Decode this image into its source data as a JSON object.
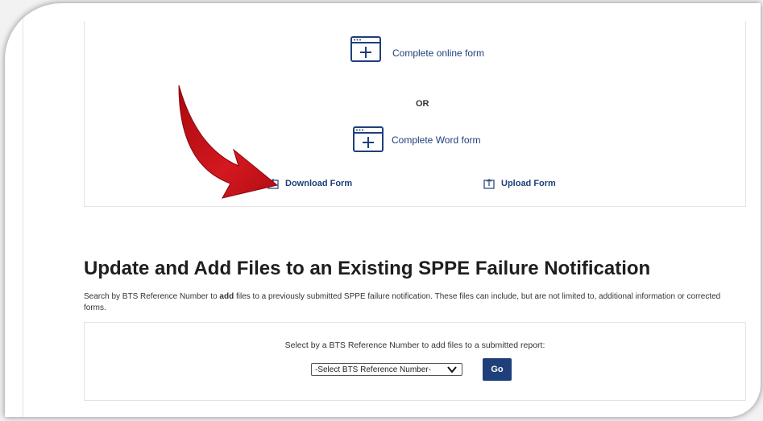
{
  "form_options": {
    "online_label": "Complete online form",
    "or_label": "OR",
    "word_label": "Complete Word form",
    "download_label": "Download Form",
    "upload_label": "Upload Form"
  },
  "update_section": {
    "title_bold": "Update and Add Files",
    "title_rest": " to an Existing SPPE Failure Notification",
    "description_pre": "Search by BTS Reference Number to ",
    "description_bold": "add",
    "description_post": " files to a previously submitted SPPE failure notification. These files can include, but are not limited to, additional information or corrected forms.",
    "select_label": "Select by a BTS Reference Number to add files to a submitted report:",
    "select_value": "-Select BTS Reference Number-",
    "go_label": "Go"
  },
  "colors": {
    "link": "#1f3f7a",
    "arrow": "#c0141a",
    "button_bg": "#1f3f7a"
  },
  "icons": [
    "window-plus-icon",
    "download-icon",
    "upload-icon",
    "chevron-down-icon",
    "arrow-annotation"
  ]
}
